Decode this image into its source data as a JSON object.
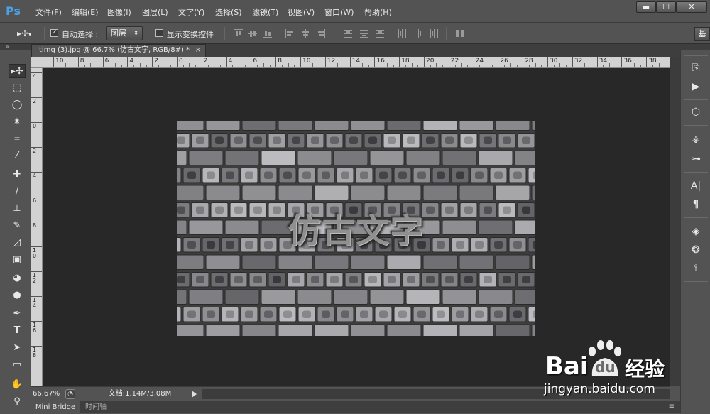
{
  "app": {
    "logo": "Ps",
    "menu": [
      "文件(F)",
      "编辑(E)",
      "图像(I)",
      "图层(L)",
      "文字(Y)",
      "选择(S)",
      "滤镜(T)",
      "视图(V)",
      "窗口(W)",
      "帮助(H)"
    ],
    "window_controls": [
      "▬",
      "☐",
      "✕"
    ]
  },
  "options_bar": {
    "auto_select_label": "自动选择 :",
    "auto_select_checked": true,
    "auto_select_target": "图层",
    "show_transform_label": "显示变换控件",
    "show_transform_checked": false,
    "workspace_label": "基"
  },
  "document": {
    "tab_title": "timg (3).jpg @ 66.7% (仿古文字, RGB/8#) *",
    "close_glyph": "×",
    "overlay_text": "仿古文字"
  },
  "ruler": {
    "h_labels": [
      "10",
      "8",
      "6",
      "4",
      "2",
      "0",
      "2",
      "4",
      "6",
      "8",
      "10",
      "12",
      "14",
      "16",
      "18",
      "20",
      "22",
      "24",
      "26",
      "28",
      "30",
      "32",
      "34",
      "36",
      "38"
    ],
    "v_labels": [
      "4",
      "2",
      "0",
      "2",
      "4",
      "6",
      "8",
      "1 0",
      "1 2",
      "1 4",
      "1 6",
      "1 8"
    ]
  },
  "status": {
    "zoom": "66.67%",
    "doc_size": "文档:1.14M/3.08M"
  },
  "bottom_tabs": {
    "mini_bridge": "Mini Bridge",
    "timeline": "时间轴"
  },
  "watermark": {
    "logo_text": "Bai",
    "logo_text2": "du",
    "logo_cn": "经验",
    "url": "jingyan.baidu.com"
  },
  "colors": {
    "ps_blue": "#4aa3e8",
    "panel_gray": "#535353",
    "canvas_bg": "#282828"
  }
}
